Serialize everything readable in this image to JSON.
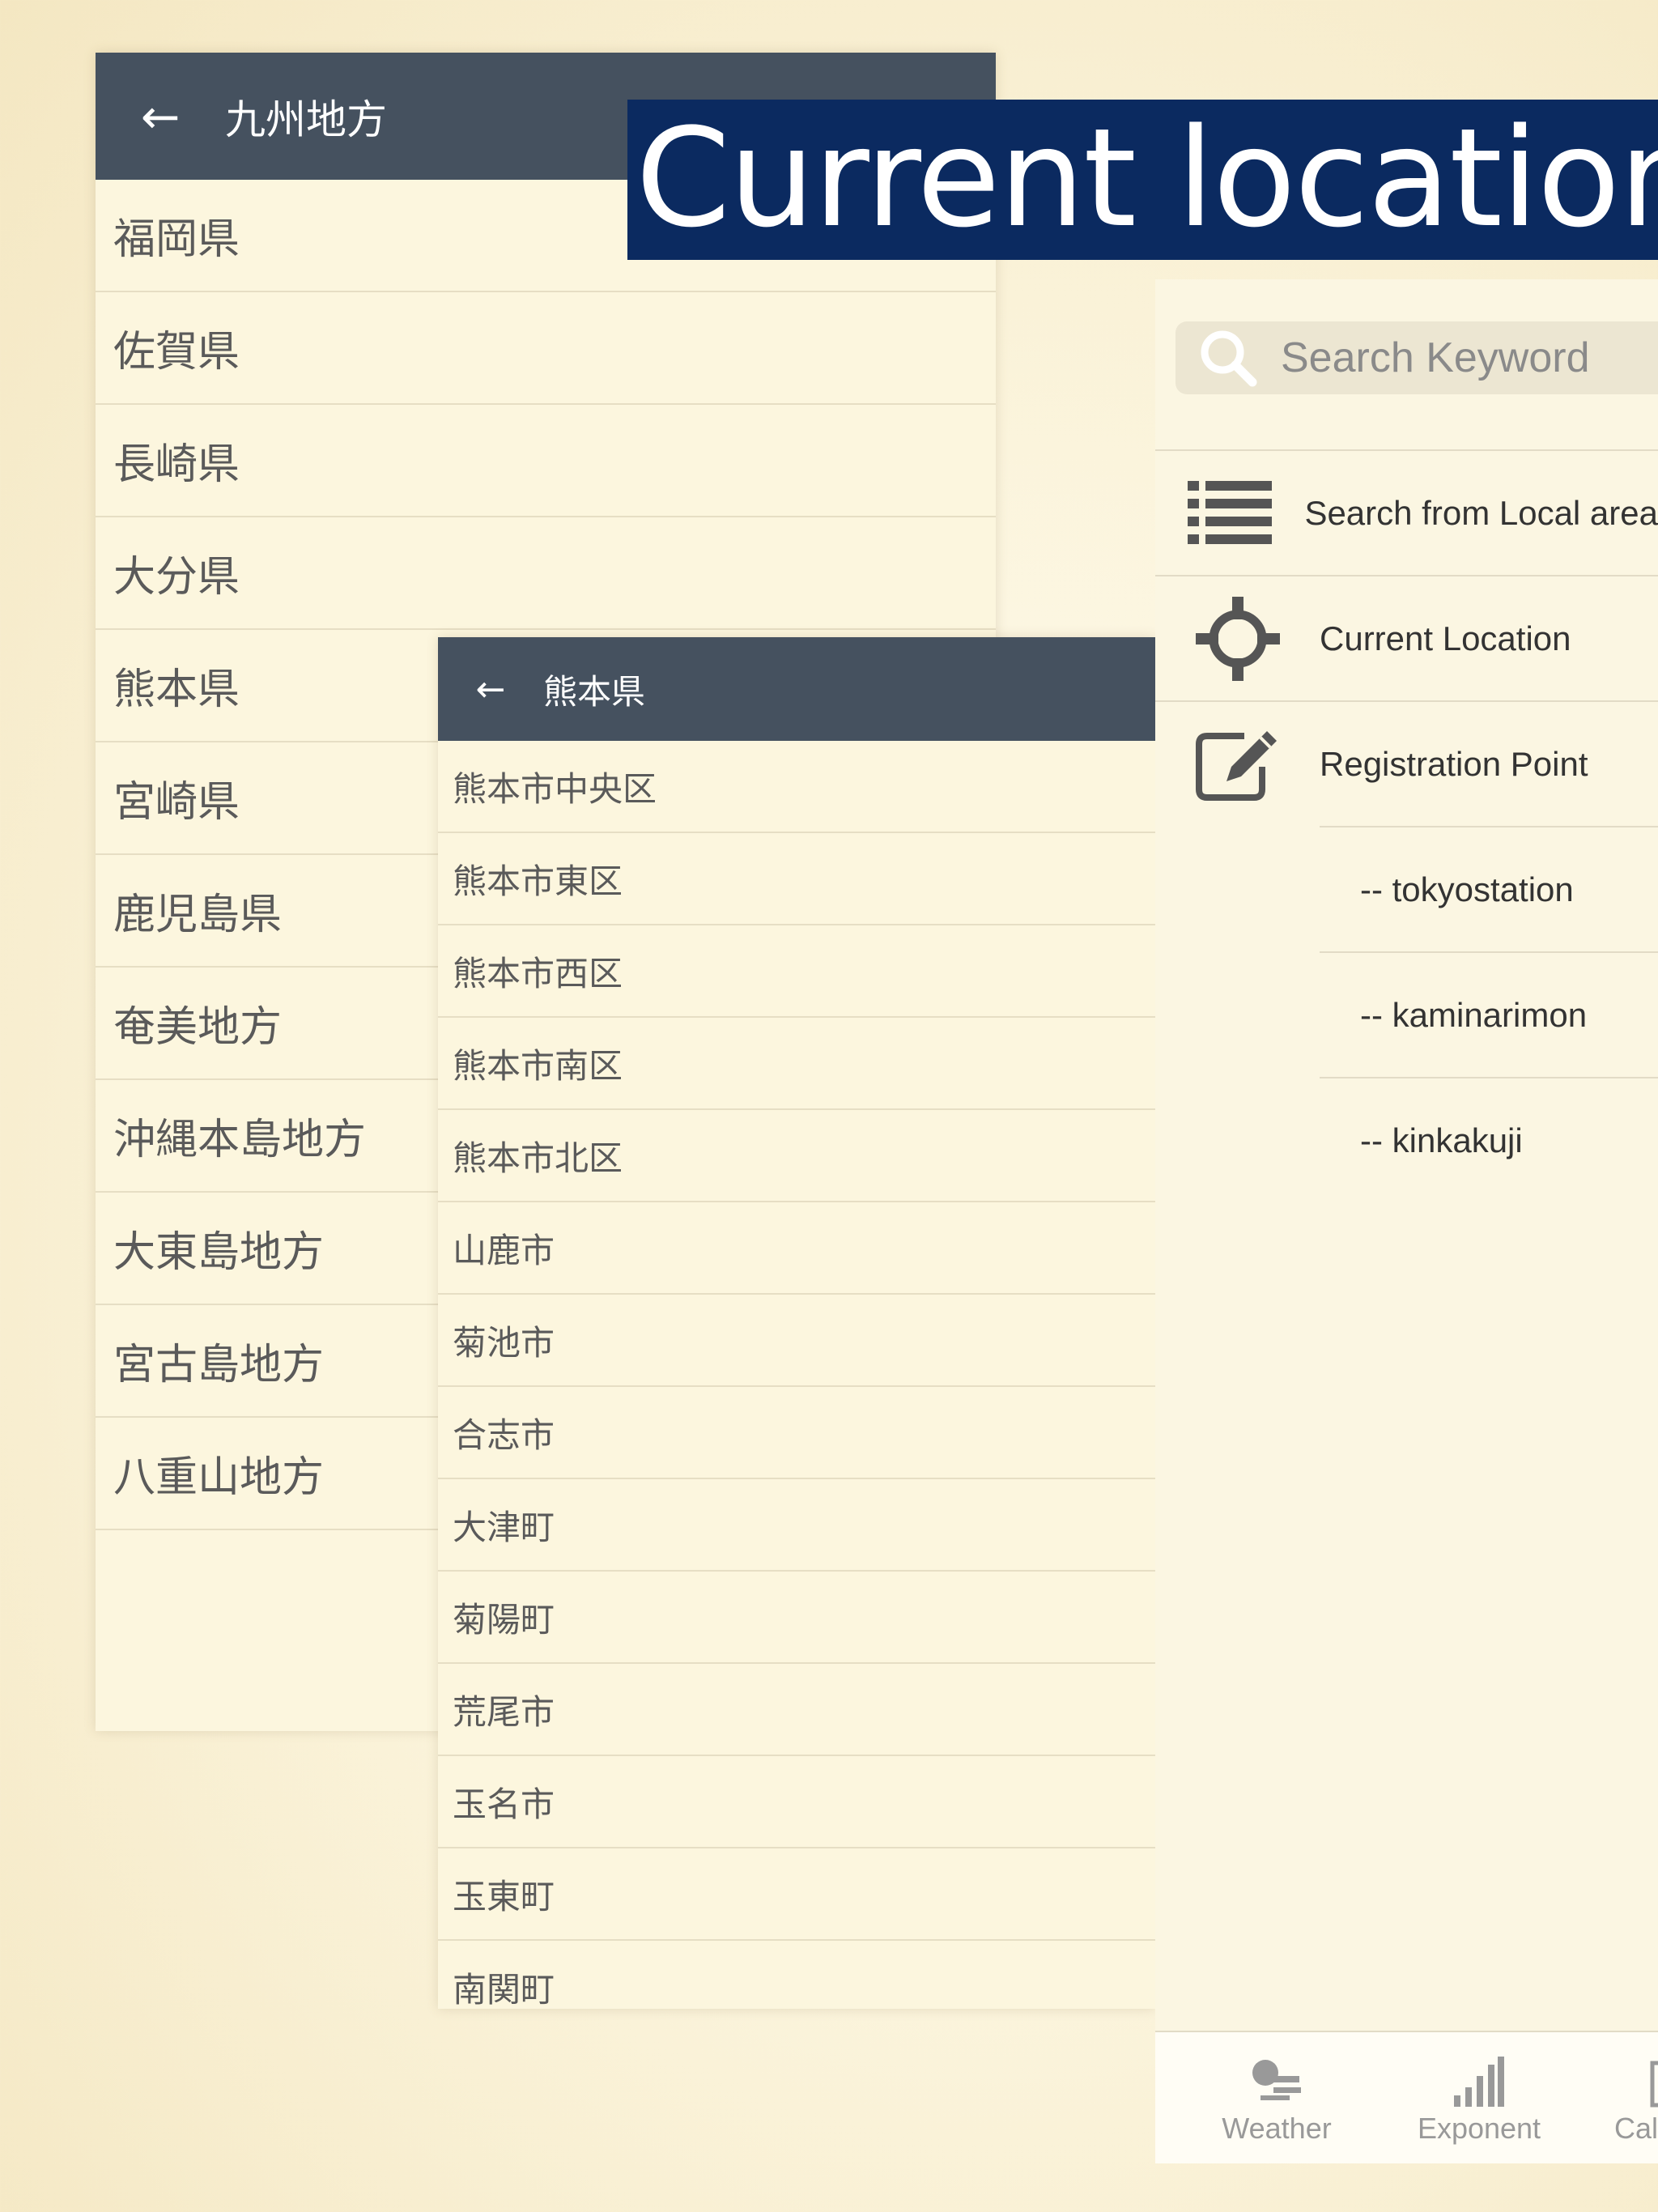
{
  "banner": {
    "text": "Current location &"
  },
  "region_panel": {
    "back_icon": "←",
    "title": "九州地方",
    "items": [
      "福岡県",
      "佐賀県",
      "長崎県",
      "大分県",
      "熊本県",
      "宮崎県",
      "鹿児島県",
      "奄美地方",
      "沖縄本島地方",
      "大東島地方",
      "宮古島地方",
      "八重山地方"
    ]
  },
  "prefecture_panel": {
    "back_icon": "←",
    "title": "熊本県",
    "items": [
      "熊本市中央区",
      "熊本市東区",
      "熊本市西区",
      "熊本市南区",
      "熊本市北区",
      "山鹿市",
      "菊池市",
      "合志市",
      "大津町",
      "菊陽町",
      "荒尾市",
      "玉名市",
      "玉東町",
      "南関町"
    ]
  },
  "search_menu": {
    "search_placeholder": "Search Keyword",
    "items": [
      {
        "label": "Search from Local area",
        "icon": "list-icon"
      },
      {
        "label": "Current Location",
        "icon": "crosshair-icon"
      },
      {
        "label": "Registration Point",
        "icon": "edit-icon"
      }
    ],
    "registered_points": [
      "-- tokyostation",
      "-- kaminarimon",
      "-- kinkakuji"
    ]
  },
  "tab_bar": {
    "tabs": [
      {
        "label": "Weather",
        "icon": "weather-icon"
      },
      {
        "label": "Exponent",
        "icon": "signal-bars-icon"
      },
      {
        "label": "Calendar",
        "icon": "calendar-icon"
      }
    ]
  },
  "colors": {
    "header": "#45515f",
    "banner": "#0b2a60",
    "panel": "#fcf6de"
  }
}
